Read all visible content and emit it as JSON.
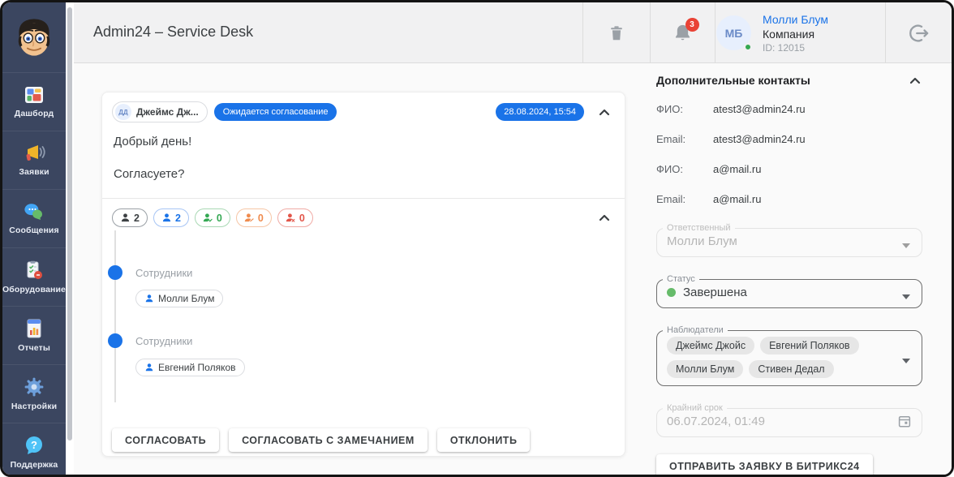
{
  "header": {
    "title": "Admin24 – Service Desk",
    "notifications_count": "3",
    "user": {
      "initials": "МБ",
      "name": "Молли Блум",
      "company": "Компания",
      "id": "ID: 12015"
    }
  },
  "sidebar": {
    "items": [
      {
        "label": "Дашборд"
      },
      {
        "label": "Заявки"
      },
      {
        "label": "Сообщения"
      },
      {
        "label": "Оборудование"
      },
      {
        "label": "Отчеты"
      },
      {
        "label": "Настройки"
      },
      {
        "label": "Поддержка"
      }
    ]
  },
  "ticket": {
    "author": {
      "initials": "ДД",
      "name": "Джеймс Дж..."
    },
    "status_badge": "Ожидается согласование",
    "date": "28.08.2024, 15:54",
    "message_line1": "Добрый день!",
    "message_line2": "Согласуете?",
    "counters": [
      {
        "name": "all",
        "value": "2",
        "color": "#3c4043"
      },
      {
        "name": "pending",
        "value": "2",
        "color": "#1a73e8"
      },
      {
        "name": "approved",
        "value": "0",
        "color": "#34a853"
      },
      {
        "name": "approved-with-remark",
        "value": "0",
        "color": "#ef8b4e"
      },
      {
        "name": "rejected",
        "value": "0",
        "color": "#e25549"
      }
    ],
    "timeline": [
      {
        "group": "Сотрудники",
        "person": "Молли Блум"
      },
      {
        "group": "Сотрудники",
        "person": "Евгений Поляков"
      }
    ],
    "actions": [
      {
        "label": "СОГЛАСОВАТЬ"
      },
      {
        "label": "СОГЛАСОВАТЬ С ЗАМЕЧАНИЕМ"
      },
      {
        "label": "ОТКЛОНИТЬ"
      }
    ]
  },
  "details": {
    "title": "Дополнительные контакты",
    "contacts": [
      {
        "label": "ФИО:",
        "value": "atest3@admin24.ru"
      },
      {
        "label": "Email:",
        "value": "atest3@admin24.ru"
      },
      {
        "label": "ФИО:",
        "value": "a@mail.ru"
      },
      {
        "label": "Email:",
        "value": "a@mail.ru"
      }
    ],
    "responsible": {
      "label": "Ответственный",
      "value": "Молли Блум"
    },
    "status": {
      "label": "Статус",
      "value": "Завершена",
      "dot_color": "#66bb6a"
    },
    "watchers": {
      "label": "Наблюдатели",
      "chips": [
        {
          "name": "Джеймс Джойс"
        },
        {
          "name": "Евгений Поляков"
        },
        {
          "name": "Молли Блум"
        },
        {
          "name": "Стивен Дедал"
        }
      ]
    },
    "deadline": {
      "label": "Крайний срок",
      "value": "06.07.2024, 01:49"
    },
    "submit_label": "ОТПРАВИТЬ ЗАЯВКУ В БИТРИКС24"
  }
}
